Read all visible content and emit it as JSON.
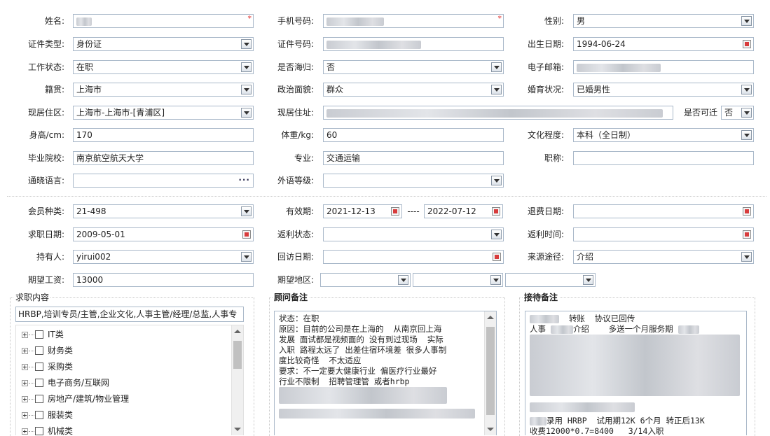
{
  "basic": {
    "name": {
      "label": "姓名:",
      "value": ""
    },
    "phone": {
      "label": "手机号码:",
      "value": ""
    },
    "gender": {
      "label": "性别:",
      "value": "男"
    },
    "id_type": {
      "label": "证件类型:",
      "value": "身份证"
    },
    "id_number": {
      "label": "证件号码:",
      "value": ""
    },
    "birth_date": {
      "label": "出生日期:",
      "value": "1994-06-24"
    },
    "work_status": {
      "label": "工作状态:",
      "value": "在职"
    },
    "overseas": {
      "label": "是否海归:",
      "value": "否"
    },
    "email": {
      "label": "电子邮箱:",
      "value": ""
    },
    "native_place": {
      "label": "籍贯:",
      "value": "上海市"
    },
    "political": {
      "label": "政治面貌:",
      "value": "群众"
    },
    "marital": {
      "label": "婚育状况:",
      "value": "已婚男性"
    },
    "residence_area": {
      "label": "现居住区:",
      "value": "上海市-上海市-[青浦区]"
    },
    "residence_addr": {
      "label": "现居住址:",
      "value": ""
    },
    "relocate": {
      "label": "是否可迁",
      "value": "否"
    },
    "height": {
      "label": "身高/cm:",
      "value": "170"
    },
    "weight": {
      "label": "体重/kg:",
      "value": "60"
    },
    "education": {
      "label": "文化程度:",
      "value": "本科（全日制）"
    },
    "school": {
      "label": "毕业院校:",
      "value": "南京航空航天大学"
    },
    "major": {
      "label": "专业:",
      "value": "交通运输"
    },
    "title": {
      "label": "职称:",
      "value": ""
    },
    "language": {
      "label": "通晓语言:",
      "value": ""
    },
    "lang_level": {
      "label": "外语等级:",
      "value": ""
    }
  },
  "member": {
    "member_type": {
      "label": "会员种类:",
      "value": "21-498"
    },
    "validity": {
      "label": "有效期:",
      "from": "2021-12-13",
      "separator": "----",
      "to": "2022-07-12"
    },
    "refund_date": {
      "label": "退费日期:",
      "value": ""
    },
    "job_date": {
      "label": "求职日期:",
      "value": "2009-05-01"
    },
    "rebate_status": {
      "label": "返利状态:",
      "value": ""
    },
    "rebate_time": {
      "label": "返利时间:",
      "value": ""
    },
    "holder": {
      "label": "持有人:",
      "value": "yirui002"
    },
    "visit_date": {
      "label": "回访日期:",
      "value": ""
    },
    "source": {
      "label": "来源途径:",
      "value": "介绍"
    },
    "salary": {
      "label": "期望工资:",
      "value": "13000"
    },
    "region": {
      "label": "期望地区:",
      "value": ""
    }
  },
  "job_content": {
    "title": "求职内容",
    "summary": "HRBP,培训专员/主管,企业文化,人事主管/经理/总监,人事专",
    "tree": [
      "IT类",
      "财务类",
      "采购类",
      "电子商务/互联网",
      "房地产/建筑/物业管理",
      "服装类",
      "机械类"
    ]
  },
  "consultant_notes": {
    "title": "顾问备注",
    "lines": [
      "状态：在职",
      "原因：目前的公司是在上海的  从南京回上海",
      "发展 面试都是视频面的 没有到过现场  实际",
      "入职 路程太远了 出差住宿环境差 很多人事制",
      "度比较奇怪  不太适应",
      "要求：不一定要大健康行业 偏医疗行业最好",
      "行业不限制  招聘管理管 或者hrbp"
    ]
  },
  "reception_notes": {
    "title": "接待备注",
    "line1": "转账  协议已回传",
    "line2a": "人事",
    "line2b": "介绍    多送一个月服务期",
    "line3": "录用 HRBP  试用期12K 6个月 转正后13K",
    "line4": "收费12000*0.7=8400   3/14入职"
  },
  "colors": {
    "required": "#e0302e",
    "field_border": "#a9b8c9",
    "calendar": "#d83b3b"
  }
}
